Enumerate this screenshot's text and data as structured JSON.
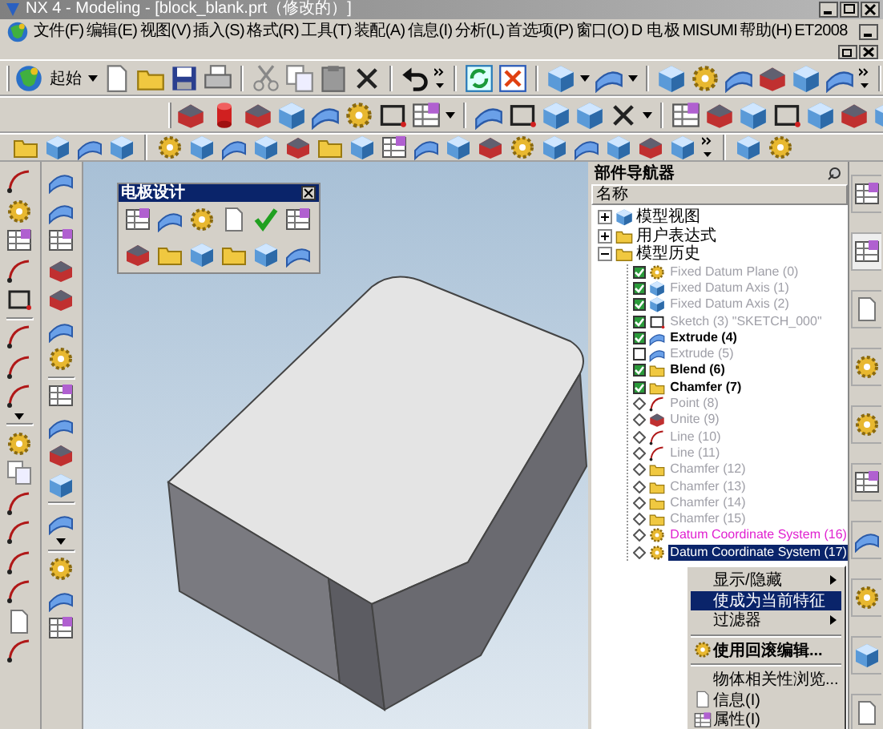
{
  "window": {
    "title": "NX 4 - Modeling - [block_blank.prt（修改的）]"
  },
  "menu": [
    "文件(F)",
    "编辑(E)",
    "视图(V)",
    "插入(S)",
    "格式(R)",
    "工具(T)",
    "装配(A)",
    "信息(I)",
    "分析(L)",
    "首选项(P)",
    "窗口(O)",
    "D 电",
    "极",
    "MISUMI",
    "帮助(H)",
    "ET2008"
  ],
  "toolbar": {
    "start_label": "起始"
  },
  "floating_toolbar": {
    "title": "电极设计"
  },
  "part_navigator": {
    "title": "部件导航器",
    "column": "名称",
    "nodes": [
      {
        "label": "模型视图",
        "expanded": false
      },
      {
        "label": "用户表达式",
        "expanded": false
      },
      {
        "label": "模型历史",
        "expanded": true,
        "children": [
          {
            "label": "Fixed Datum Plane (0)",
            "kind": "checkbox",
            "checked": true,
            "disabled": true,
            "highlighted": false,
            "selected": false
          },
          {
            "label": "Fixed Datum Axis (1)",
            "kind": "checkbox",
            "checked": true,
            "disabled": true,
            "highlighted": false,
            "selected": false
          },
          {
            "label": "Fixed Datum Axis (2)",
            "kind": "checkbox",
            "checked": true,
            "disabled": true,
            "highlighted": false,
            "selected": false
          },
          {
            "label": "Sketch (3) \"SKETCH_000\"",
            "kind": "checkbox",
            "checked": true,
            "disabled": true,
            "highlighted": false,
            "selected": false
          },
          {
            "label": "Extrude (4)",
            "kind": "checkbox",
            "checked": true,
            "disabled": false,
            "highlighted": false,
            "selected": false
          },
          {
            "label": "Extrude (5)",
            "kind": "checkbox",
            "checked": false,
            "disabled": true,
            "highlighted": false,
            "selected": false
          },
          {
            "label": "Blend (6)",
            "kind": "checkbox",
            "checked": true,
            "disabled": false,
            "highlighted": false,
            "selected": false
          },
          {
            "label": "Chamfer (7)",
            "kind": "checkbox",
            "checked": true,
            "disabled": false,
            "highlighted": false,
            "selected": false
          },
          {
            "label": "Point (8)",
            "kind": "diamond",
            "disabled": true,
            "highlighted": false,
            "selected": false
          },
          {
            "label": "Unite (9)",
            "kind": "diamond",
            "disabled": true,
            "highlighted": false,
            "selected": false
          },
          {
            "label": "Line (10)",
            "kind": "diamond",
            "disabled": true,
            "highlighted": false,
            "selected": false
          },
          {
            "label": "Line (11)",
            "kind": "diamond",
            "disabled": true,
            "highlighted": false,
            "selected": false
          },
          {
            "label": "Chamfer (12)",
            "kind": "diamond",
            "disabled": true,
            "highlighted": false,
            "selected": false
          },
          {
            "label": "Chamfer (13)",
            "kind": "diamond",
            "disabled": true,
            "highlighted": false,
            "selected": false
          },
          {
            "label": "Chamfer (14)",
            "kind": "diamond",
            "disabled": true,
            "highlighted": false,
            "selected": false
          },
          {
            "label": "Chamfer (15)",
            "kind": "diamond",
            "disabled": true,
            "highlighted": false,
            "selected": false
          },
          {
            "label": "Datum Coordinate System (16)",
            "kind": "diamond",
            "disabled": false,
            "highlighted": true,
            "selected": false
          },
          {
            "label": "Datum Coordinate System (17)",
            "kind": "diamond",
            "disabled": false,
            "highlighted": false,
            "selected": true
          }
        ]
      }
    ]
  },
  "context_menu": [
    {
      "label": "显示/隐藏",
      "kind": "submenu",
      "selected": false,
      "default": false
    },
    {
      "label": "使成为当前特征",
      "kind": "action",
      "selected": true,
      "default": false
    },
    {
      "label": "过滤器",
      "kind": "submenu",
      "selected": false,
      "default": false
    },
    {
      "kind": "separator"
    },
    {
      "label": "使用回滚编辑...",
      "kind": "action",
      "selected": false,
      "default": true
    },
    {
      "kind": "separator"
    },
    {
      "label": "物体相关性浏览...",
      "kind": "action",
      "selected": false,
      "default": false
    },
    {
      "label": "信息(I)",
      "kind": "action",
      "selected": false,
      "default": false
    },
    {
      "label": "属性(I)",
      "kind": "action",
      "selected": false,
      "default": false
    }
  ]
}
